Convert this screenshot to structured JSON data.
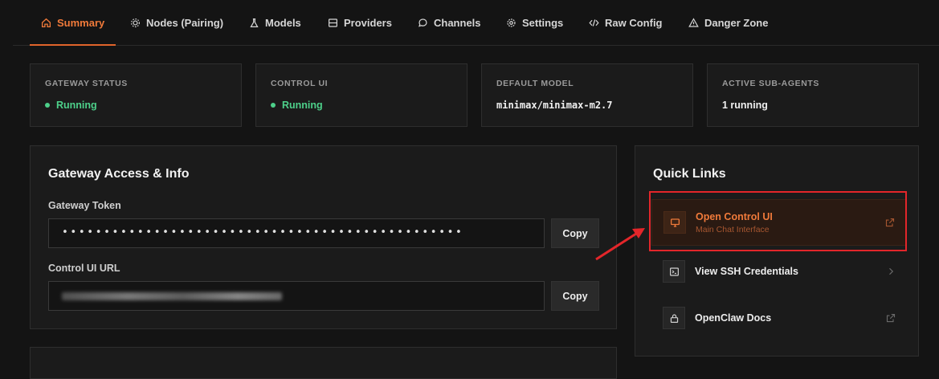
{
  "tabs": [
    {
      "label": "Summary",
      "icon": "home-icon",
      "active": true
    },
    {
      "label": "Nodes (Pairing)",
      "icon": "cpu-icon"
    },
    {
      "label": "Models",
      "icon": "flask-icon"
    },
    {
      "label": "Providers",
      "icon": "server-icon"
    },
    {
      "label": "Channels",
      "icon": "chat-icon"
    },
    {
      "label": "Settings",
      "icon": "gear-icon"
    },
    {
      "label": "Raw Config",
      "icon": "code-icon"
    },
    {
      "label": "Danger Zone",
      "icon": "warning-icon"
    }
  ],
  "stats": [
    {
      "label": "GATEWAY STATUS",
      "value": "Running",
      "status": "ok"
    },
    {
      "label": "CONTROL UI",
      "value": "Running",
      "status": "ok"
    },
    {
      "label": "DEFAULT MODEL",
      "value": "minimax/minimax-m2.7"
    },
    {
      "label": "ACTIVE SUB-AGENTS",
      "value": "1 running"
    }
  ],
  "gateway": {
    "title": "Gateway Access & Info",
    "token_label": "Gateway Token",
    "token_value": "••••••••••••••••••••••••••••••••••••••••••••••••",
    "url_label": "Control UI URL",
    "copy_label": "Copy"
  },
  "quick_links": {
    "title": "Quick Links",
    "items": [
      {
        "title": "Open Control UI",
        "subtitle": "Main Chat Interface",
        "icon": "monitor-icon",
        "trail": "external-link-icon"
      },
      {
        "title": "View SSH Credentials",
        "icon": "terminal-icon",
        "trail": "chevron-right-icon"
      },
      {
        "title": "OpenClaw Docs",
        "icon": "lock-icon",
        "trail": "external-link-icon"
      }
    ]
  },
  "colors": {
    "accent": "#f07a3a",
    "success": "#4dd08a",
    "highlight": "#e3262a",
    "background": "#141414",
    "card": "#1b1b1b"
  }
}
